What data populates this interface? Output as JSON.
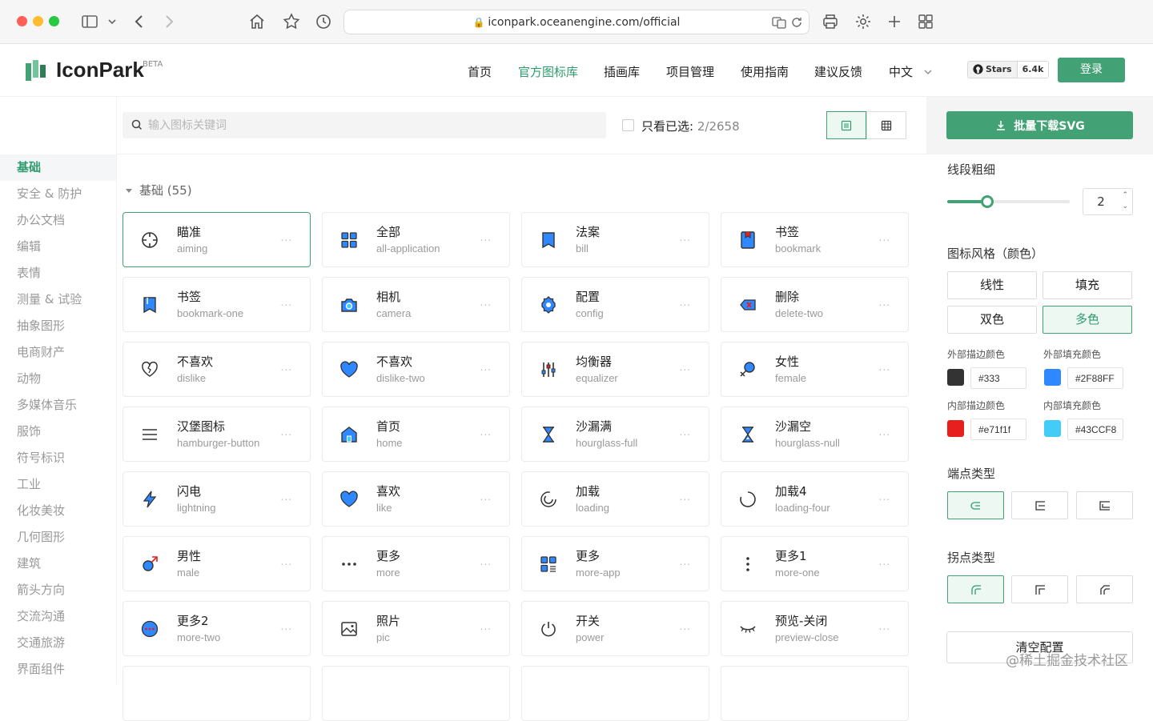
{
  "browser": {
    "url": "iconpark.oceanengine.com/official"
  },
  "header": {
    "logo_text": "IconPark",
    "beta": "BETA",
    "nav": [
      "首页",
      "官方图标库",
      "插画库",
      "项目管理",
      "使用指南",
      "建议反馈",
      "中文"
    ],
    "active_nav": "官方图标库",
    "github_stars_label": "Stars",
    "github_stars_count": "6.4k",
    "login": "登录"
  },
  "sidebar": {
    "active": "基础",
    "items": [
      "基础",
      "安全 & 防护",
      "办公文档",
      "编辑",
      "表情",
      "测量 & 试验",
      "抽象图形",
      "电商财产",
      "动物",
      "多媒体音乐",
      "服饰",
      "符号标识",
      "工业",
      "化妆美妆",
      "几何图形",
      "建筑",
      "箭头方向",
      "交流沟通",
      "交通旅游",
      "界面组件"
    ]
  },
  "toolbar": {
    "search_placeholder": "输入图标关键词",
    "selected_only_label": "只看已选:",
    "selected_count": "2/2658"
  },
  "section": {
    "title": "基础 (55)"
  },
  "icons": [
    {
      "cn": "瞄准",
      "en": "aiming",
      "icon": "aiming-icon"
    },
    {
      "cn": "全部",
      "en": "all-application",
      "icon": "all-application-icon"
    },
    {
      "cn": "法案",
      "en": "bill",
      "icon": "bill-icon"
    },
    {
      "cn": "书签",
      "en": "bookmark",
      "icon": "bookmark-icon"
    },
    {
      "cn": "书签",
      "en": "bookmark-one",
      "icon": "bookmark-one-icon"
    },
    {
      "cn": "相机",
      "en": "camera",
      "icon": "camera-icon"
    },
    {
      "cn": "配置",
      "en": "config",
      "icon": "config-icon"
    },
    {
      "cn": "删除",
      "en": "delete-two",
      "icon": "delete-two-icon"
    },
    {
      "cn": "不喜欢",
      "en": "dislike",
      "icon": "dislike-icon"
    },
    {
      "cn": "不喜欢",
      "en": "dislike-two",
      "icon": "dislike-two-icon"
    },
    {
      "cn": "均衡器",
      "en": "equalizer",
      "icon": "equalizer-icon"
    },
    {
      "cn": "女性",
      "en": "female",
      "icon": "female-icon"
    },
    {
      "cn": "汉堡图标",
      "en": "hamburger-button",
      "icon": "hamburger-icon"
    },
    {
      "cn": "首页",
      "en": "home",
      "icon": "home-icon"
    },
    {
      "cn": "沙漏满",
      "en": "hourglass-full",
      "icon": "hourglass-full-icon"
    },
    {
      "cn": "沙漏空",
      "en": "hourglass-null",
      "icon": "hourglass-null-icon"
    },
    {
      "cn": "闪电",
      "en": "lightning",
      "icon": "lightning-icon"
    },
    {
      "cn": "喜欢",
      "en": "like",
      "icon": "like-icon"
    },
    {
      "cn": "加载",
      "en": "loading",
      "icon": "loading-icon"
    },
    {
      "cn": "加载4",
      "en": "loading-four",
      "icon": "loading-four-icon"
    },
    {
      "cn": "男性",
      "en": "male",
      "icon": "male-icon"
    },
    {
      "cn": "更多",
      "en": "more",
      "icon": "more-icon"
    },
    {
      "cn": "更多",
      "en": "more-app",
      "icon": "more-app-icon"
    },
    {
      "cn": "更多1",
      "en": "more-one",
      "icon": "more-one-icon"
    },
    {
      "cn": "更多2",
      "en": "more-two",
      "icon": "more-two-icon"
    },
    {
      "cn": "照片",
      "en": "pic",
      "icon": "pic-icon"
    },
    {
      "cn": "开关",
      "en": "power",
      "icon": "power-icon"
    },
    {
      "cn": "预览-关闭",
      "en": "preview-close",
      "icon": "preview-close-icon"
    }
  ],
  "card_more": "...",
  "panel": {
    "download": "批量下载SVG",
    "stroke_width_label": "线段粗细",
    "stroke_width": "2",
    "stroke_slider_fraction": 0.33,
    "style_label": "图标风格（颜色）",
    "styles": [
      "线性",
      "填充",
      "双色",
      "多色"
    ],
    "active_style": "多色",
    "colors": [
      {
        "label": "外部描边颜色",
        "value": "#333",
        "swatch": "#333333"
      },
      {
        "label": "外部填充颜色",
        "value": "#2F88FF",
        "swatch": "#2F88FF"
      },
      {
        "label": "内部描边颜色",
        "value": "#e71f1f",
        "swatch": "#e71f1f"
      },
      {
        "label": "内部填充颜色",
        "value": "#43CCF8",
        "swatch": "#43CCF8"
      }
    ],
    "linecap_label": "端点类型",
    "linejoin_label": "拐点类型",
    "clear": "清空配置"
  },
  "watermark": "@稀土掘金技术社区",
  "accent": "#43a275"
}
